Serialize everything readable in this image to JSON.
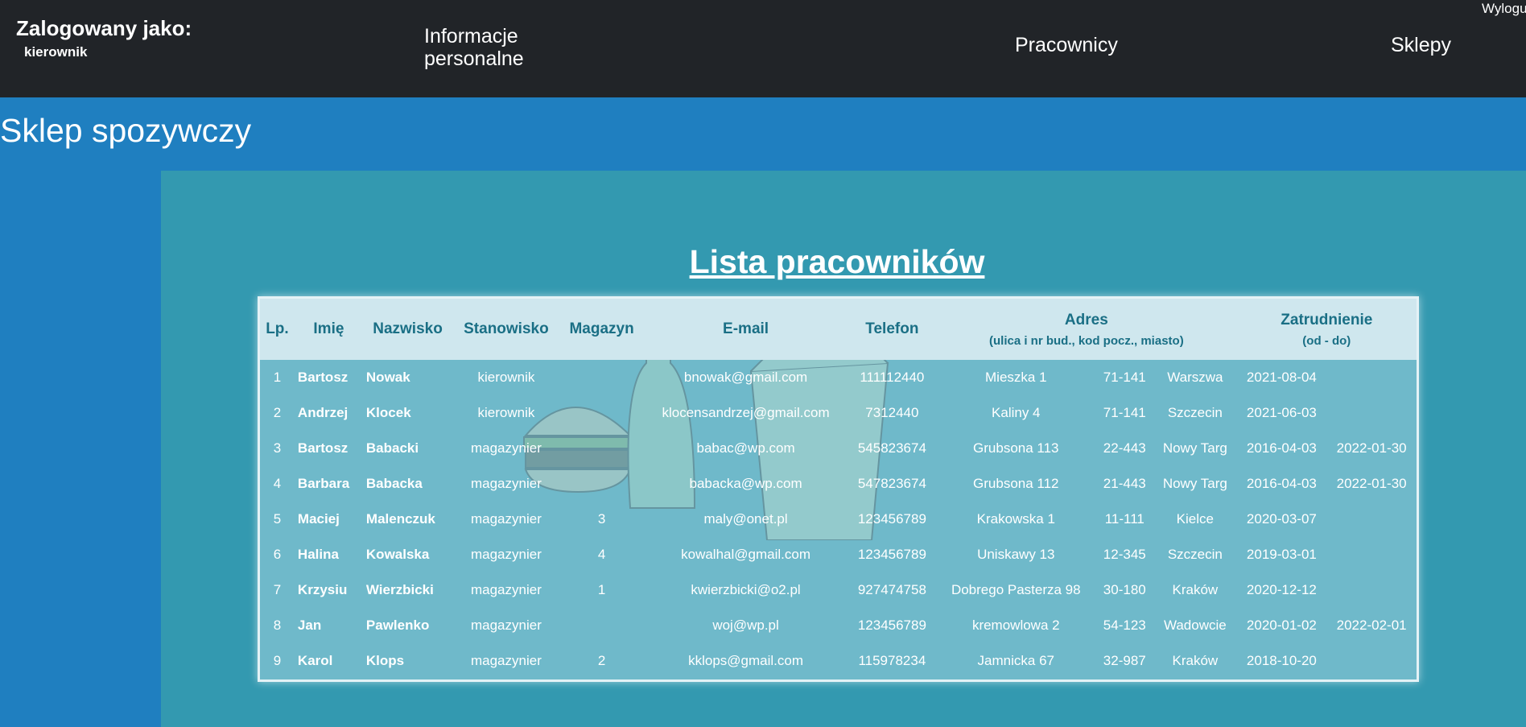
{
  "header": {
    "login_label": "Zalogowany jako:",
    "login_user": "kierownik",
    "nav": {
      "info": "Informacje personalne",
      "workers": "Pracownicy",
      "shops": "Sklepy"
    },
    "logout": "Wyloguj"
  },
  "page": {
    "title": "Sklep spozywczy",
    "list_title": "Lista pracowników"
  },
  "table": {
    "headers": {
      "lp": "Lp.",
      "first": "Imię",
      "last": "Nazwisko",
      "position": "Stanowisko",
      "warehouse": "Magazyn",
      "email": "E-mail",
      "phone": "Telefon",
      "address": "Adres",
      "address_sub": "(ulica i nr bud., kod pocz., miasto)",
      "employment": "Zatrudnienie",
      "employment_sub": "(od - do)"
    },
    "rows": [
      {
        "lp": "1",
        "first": "Bartosz",
        "last": "Nowak",
        "position": "kierownik",
        "warehouse": "",
        "email": "bnowak@gmail.com",
        "phone": "111112440",
        "street": "Mieszka 1",
        "zip": "71-141",
        "city": "Warszwa",
        "from": "2021-08-04",
        "to": ""
      },
      {
        "lp": "2",
        "first": "Andrzej",
        "last": "Klocek",
        "position": "kierownik",
        "warehouse": "",
        "email": "klocensandrzej@gmail.com",
        "phone": "7312440",
        "street": "Kaliny 4",
        "zip": "71-141",
        "city": "Szczecin",
        "from": "2021-06-03",
        "to": ""
      },
      {
        "lp": "3",
        "first": "Bartosz",
        "last": "Babacki",
        "position": "magazynier",
        "warehouse": "",
        "email": "babac@wp.com",
        "phone": "545823674",
        "street": "Grubsona 113",
        "zip": "22-443",
        "city": "Nowy Targ",
        "from": "2016-04-03",
        "to": "2022-01-30"
      },
      {
        "lp": "4",
        "first": "Barbara",
        "last": "Babacka",
        "position": "magazynier",
        "warehouse": "",
        "email": "babacka@wp.com",
        "phone": "547823674",
        "street": "Grubsona 112",
        "zip": "21-443",
        "city": "Nowy Targ",
        "from": "2016-04-03",
        "to": "2022-01-30"
      },
      {
        "lp": "5",
        "first": "Maciej",
        "last": "Malenczuk",
        "position": "magazynier",
        "warehouse": "3",
        "email": "maly@onet.pl",
        "phone": "123456789",
        "street": "Krakowska 1",
        "zip": "11-111",
        "city": "Kielce",
        "from": "2020-03-07",
        "to": ""
      },
      {
        "lp": "6",
        "first": "Halina",
        "last": "Kowalska",
        "position": "magazynier",
        "warehouse": "4",
        "email": "kowalhal@gmail.com",
        "phone": "123456789",
        "street": "Uniskawy 13",
        "zip": "12-345",
        "city": "Szczecin",
        "from": "2019-03-01",
        "to": ""
      },
      {
        "lp": "7",
        "first": "Krzysiu",
        "last": "Wierzbicki",
        "position": "magazynier",
        "warehouse": "1",
        "email": "kwierzbicki@o2.pl",
        "phone": "927474758",
        "street": "Dobrego Pasterza 98",
        "zip": "30-180",
        "city": "Kraków",
        "from": "2020-12-12",
        "to": ""
      },
      {
        "lp": "8",
        "first": "Jan",
        "last": "Pawlenko",
        "position": "magazynier",
        "warehouse": "",
        "email": "woj@wp.pl",
        "phone": "123456789",
        "street": "kremowlowa 2",
        "zip": "54-123",
        "city": "Wadowcie",
        "from": "2020-01-02",
        "to": "2022-02-01"
      },
      {
        "lp": "9",
        "first": "Karol",
        "last": "Klops",
        "position": "magazynier",
        "warehouse": "2",
        "email": "kklops@gmail.com",
        "phone": "115978234",
        "street": "Jamnicka 67",
        "zip": "32-987",
        "city": "Kraków",
        "from": "2018-10-20",
        "to": ""
      }
    ]
  },
  "colors": {
    "topbar": "#212428",
    "page_bg": "#1f7fc0",
    "content_bg": "#3399b0",
    "table_bg": "#6fb9ca",
    "header_row_bg": "#cfe7ee",
    "header_text": "#1a6f85"
  }
}
